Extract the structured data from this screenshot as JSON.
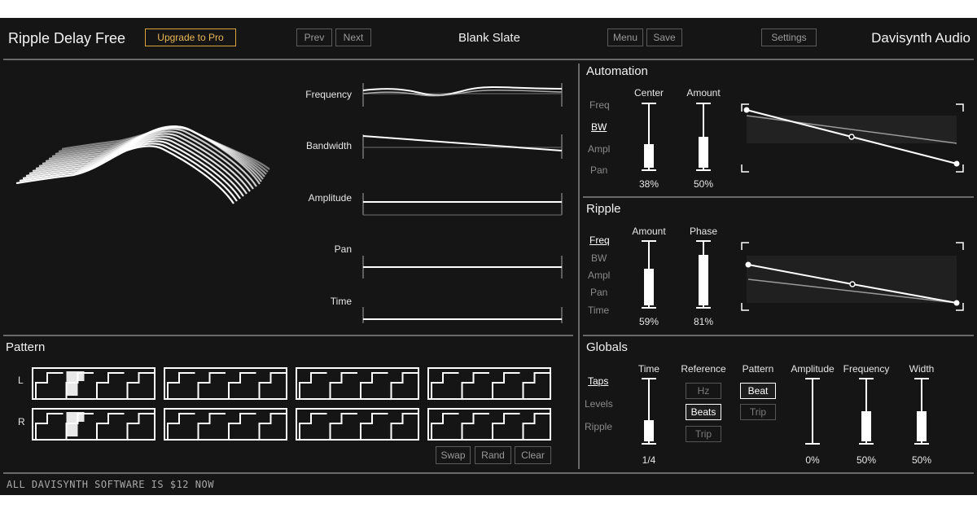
{
  "header": {
    "app_title": "Ripple Delay Free",
    "upgrade_label": "Upgrade to Pro",
    "prev_label": "Prev",
    "next_label": "Next",
    "preset_name": "Blank Slate",
    "menu_label": "Menu",
    "save_label": "Save",
    "settings_label": "Settings",
    "brand": "Davisynth Audio"
  },
  "lanes": [
    "Frequency",
    "Bandwidth",
    "Amplitude",
    "Pan",
    "Time"
  ],
  "automation": {
    "title": "Automation",
    "params": [
      "Freq",
      "BW",
      "Ampl",
      "Pan"
    ],
    "active_param": "BW",
    "sliders": [
      {
        "label": "Center",
        "value": "38%",
        "level": 0.38
      },
      {
        "label": "Amount",
        "value": "50%",
        "level": 0.5
      }
    ]
  },
  "ripple": {
    "title": "Ripple",
    "params": [
      "Freq",
      "BW",
      "Ampl",
      "Pan",
      "Time"
    ],
    "active_param": "Freq",
    "sliders": [
      {
        "label": "Amount",
        "value": "59%",
        "level": 0.59
      },
      {
        "label": "Phase",
        "value": "81%",
        "level": 0.81
      }
    ]
  },
  "pattern": {
    "title": "Pattern",
    "channels": [
      "L",
      "R"
    ],
    "buttons": {
      "swap": "Swap",
      "rand": "Rand",
      "clear": "Clear"
    }
  },
  "globals": {
    "title": "Globals",
    "modes": [
      "Taps",
      "Levels",
      "Ripple"
    ],
    "active_mode": "Taps",
    "time": {
      "label": "Time",
      "value": "1/4",
      "level": 0.35
    },
    "reference": {
      "label": "Reference",
      "options": [
        "Hz",
        "Beats",
        "Trip"
      ],
      "selected": "Beats"
    },
    "pattern": {
      "label": "Pattern",
      "options": [
        "Beat",
        "Trip"
      ],
      "selected": "Beat"
    },
    "amplitude": {
      "label": "Amplitude",
      "value": "0%",
      "level": 0.0
    },
    "frequency": {
      "label": "Frequency",
      "value": "50%",
      "level": 0.5
    },
    "width": {
      "label": "Width",
      "value": "50%",
      "level": 0.5
    }
  },
  "footer": {
    "text": "ALL DAVISYNTH SOFTWARE IS $12 NOW"
  }
}
